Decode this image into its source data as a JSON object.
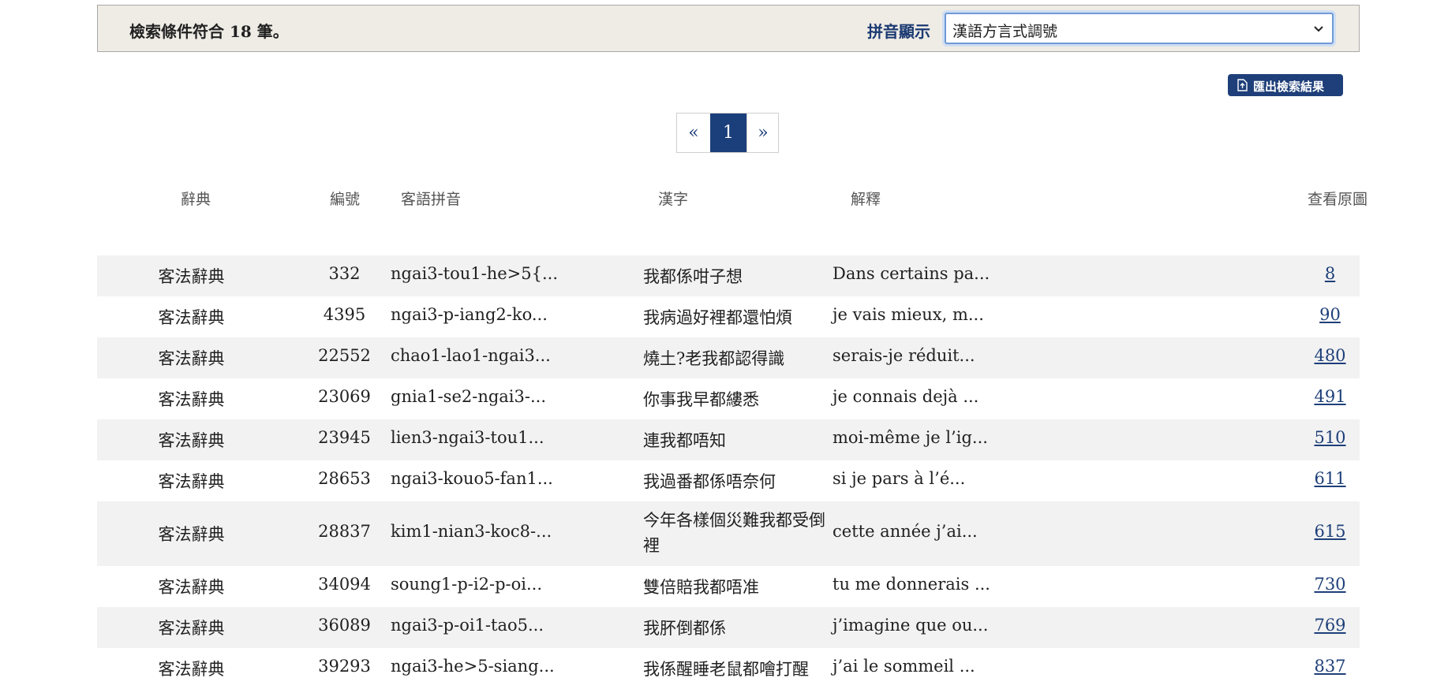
{
  "search_bar": {
    "result_count_text": "檢索條件符合 18 筆。",
    "pinyin_label": "拼音顯示",
    "pinyin_select": {
      "selected": "漢語方言式調號"
    }
  },
  "export_button": {
    "label": "匯出檢索結果",
    "icon": "export-file-icon"
  },
  "pagination": {
    "prev": "«",
    "current": "1",
    "next": "»"
  },
  "table": {
    "headers": {
      "dictionary": "辭典",
      "number": "編號",
      "hakka_pinyin": "客語拼音",
      "chinese": "漢字",
      "explanation": "解釋",
      "view_image": "查看原圖"
    },
    "rows": [
      {
        "dictionary": "客法辭典",
        "number": "332",
        "pinyin": "ngai3-tou1-he>5{...",
        "chinese": "我都係咁子想",
        "explanation": "Dans certains pa...",
        "page": "8"
      },
      {
        "dictionary": "客法辭典",
        "number": "4395",
        "pinyin": "ngai3-p-iang2-ko...",
        "chinese": "我病過好裡都還怕煩",
        "explanation": "je vais mieux, m...",
        "page": "90"
      },
      {
        "dictionary": "客法辭典",
        "number": "22552",
        "pinyin": "chao1-lao1-ngai3...",
        "chinese": "燒土?老我都認得識",
        "explanation": "serais-je réduit...",
        "page": "480"
      },
      {
        "dictionary": "客法辭典",
        "number": "23069",
        "pinyin": "gnia1-se2-ngai3-...",
        "chinese": "你事我早都縷悉",
        "explanation": "je connais dejà ...",
        "page": "491"
      },
      {
        "dictionary": "客法辭典",
        "number": "23945",
        "pinyin": "lien3-ngai3-tou1...",
        "chinese": "連我都唔知",
        "explanation": "moi-même je l’ig...",
        "page": "510"
      },
      {
        "dictionary": "客法辭典",
        "number": "28653",
        "pinyin": "ngai3-kouo5-fan1...",
        "chinese": "我過番都係唔奈何",
        "explanation": "si je pars à l’é...",
        "page": "611"
      },
      {
        "dictionary": "客法辭典",
        "number": "28837",
        "pinyin": "kim1-nian3-koc8-...",
        "chinese": "今年各樣個災難我都受倒裡",
        "explanation": "cette année j’ai...",
        "page": "615"
      },
      {
        "dictionary": "客法辭典",
        "number": "34094",
        "pinyin": "soung1-p-i2-p-oi...",
        "chinese": "雙倍賠我都唔准",
        "explanation": "tu me donnerais ...",
        "page": "730"
      },
      {
        "dictionary": "客法辭典",
        "number": "36089",
        "pinyin": "ngai3-p-oi1-tao5...",
        "chinese": "我肧倒都係",
        "explanation": "j’imagine que ou...",
        "page": "769"
      },
      {
        "dictionary": "客法辭典",
        "number": "39293",
        "pinyin": "ngai3-he>5-siang...",
        "chinese": "我係醒睡老鼠都噲打醒",
        "explanation": "j’ai le sommeil ...",
        "page": "837"
      }
    ]
  }
}
